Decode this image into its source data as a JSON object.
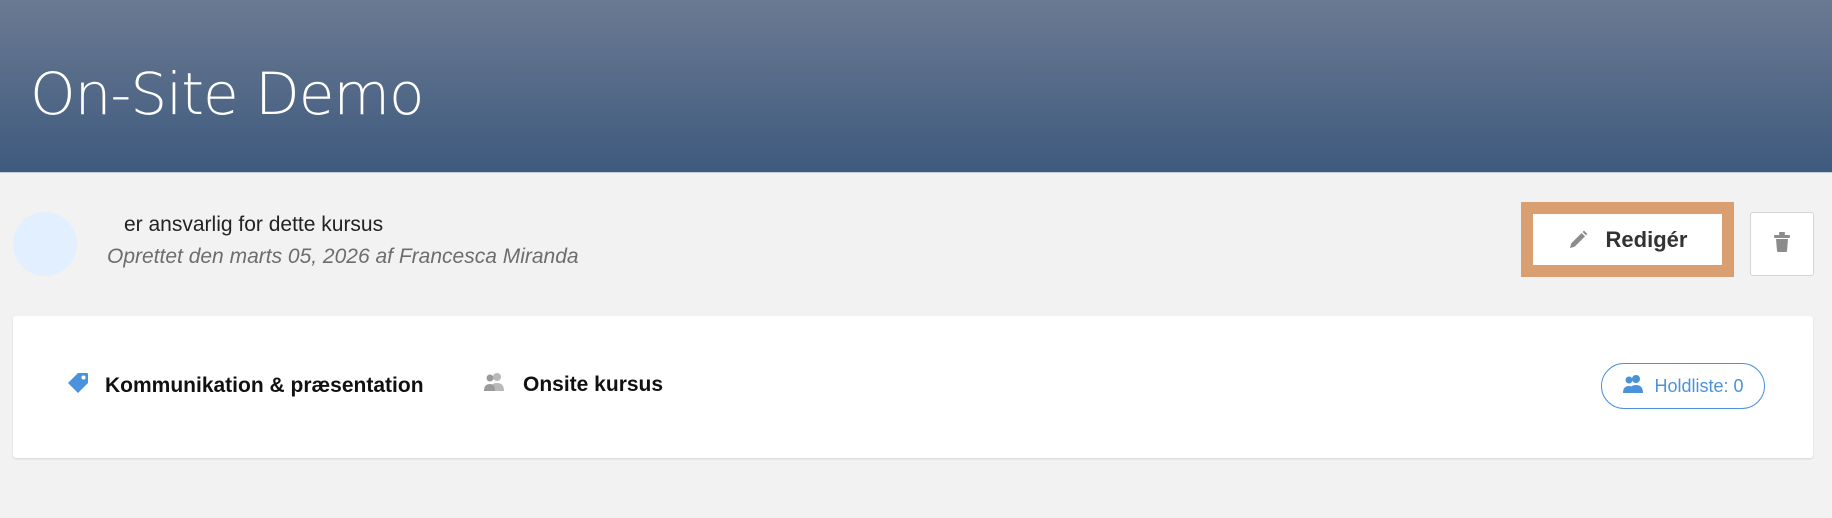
{
  "header": {
    "title": "On-Site Demo",
    "background_top": "#6b7a92",
    "background_bottom": "#3e5a7e"
  },
  "meta": {
    "responsible_text": "er ansvarlig for dette kursus",
    "created_text": "Oprettet den marts 05, 2026 af Francesca  Miranda",
    "avatar_color": "#e2efff"
  },
  "actions": {
    "edit_label": "Redigér",
    "edit_icon": "pencil-icon",
    "delete_icon": "trash-icon",
    "highlight_color": "#d99f71"
  },
  "details": {
    "category_icon": "tag-icon",
    "category_label": "Kommunikation & præsentation",
    "type_icon": "users-icon",
    "type_label": "Onsite kursus",
    "roster_icon": "users-icon",
    "roster_label": "Holdliste: 0",
    "accent_color": "#4b92dc"
  }
}
